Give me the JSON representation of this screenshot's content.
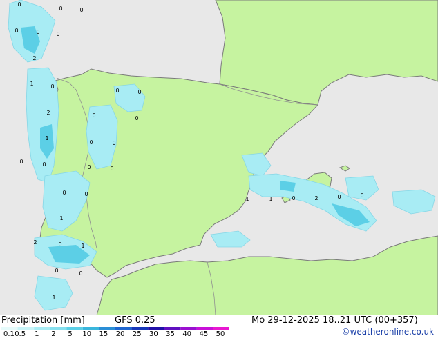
{
  "map": {
    "point_labels": [
      "0",
      "0",
      "0",
      "0",
      "0",
      "2",
      "0",
      "1",
      "0",
      "2",
      "1",
      "0",
      "0",
      "0",
      "0",
      "0",
      "0",
      "0",
      "0",
      "0",
      "0",
      "0",
      "0",
      "1",
      "2",
      "0",
      "1",
      "0",
      "0",
      "1",
      "1",
      "1",
      "0",
      "2",
      "0",
      "0"
    ],
    "colors": {
      "sea": "#e8e8e8",
      "land": "#c6f3a0",
      "coast": "#7a7a7a",
      "border": "#909090"
    }
  },
  "footer": {
    "title": "Precipitation [mm]",
    "model": "GFS 0.25",
    "datetime": "Mo 29-12-2025 18..21 UTC (00+357)",
    "credit": "©weatheronline.co.uk",
    "legend_labels": [
      "0.1",
      "0.5",
      "1",
      "2",
      "5",
      "10",
      "15",
      "20",
      "25",
      "30",
      "35",
      "40",
      "45",
      "50"
    ],
    "legend_colors": [
      "#e6fbfb",
      "#c8f4f8",
      "#a8ecf4",
      "#86e0ee",
      "#5ccfe6",
      "#3ab6dc",
      "#2a8ed6",
      "#1e66d0",
      "#1636b8",
      "#2010a8",
      "#6010c0",
      "#9a10d0",
      "#c810d8",
      "#e818d0"
    ]
  }
}
